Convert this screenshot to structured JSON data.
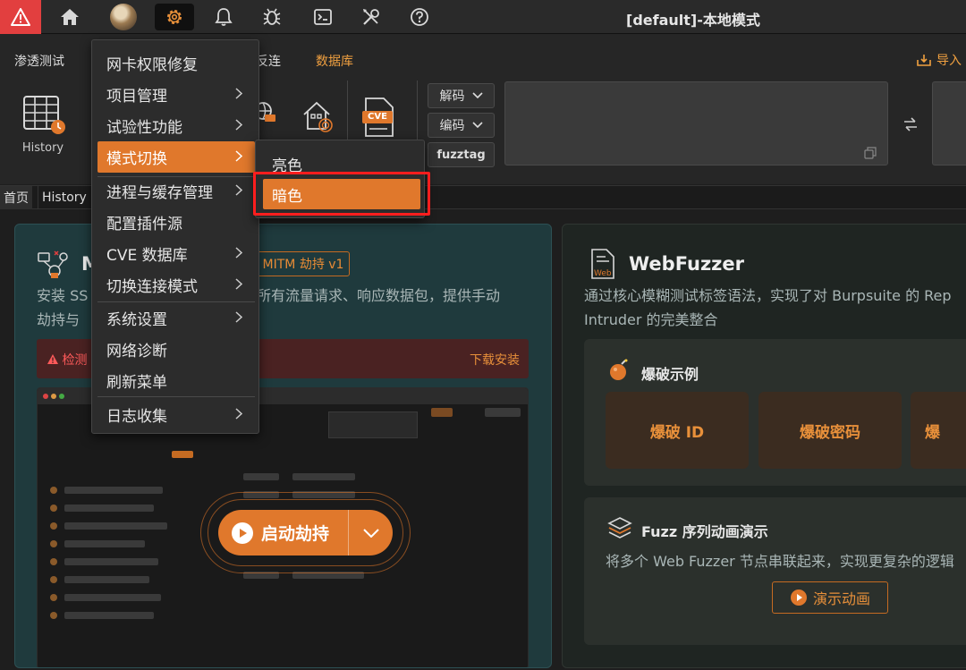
{
  "titlebar": {
    "title": "[default]-本地模式",
    "icons": [
      "warning-icon",
      "home-icon",
      "avatar",
      "gear-icon",
      "bell-icon",
      "bug-icon",
      "terminal-icon",
      "tools-icon",
      "help-icon"
    ]
  },
  "toolbar": {
    "tabs": [
      "渗透测试",
      "反连",
      "数据库"
    ],
    "import_label": "导入",
    "history_label": "History",
    "decode_label": "解码",
    "encode_label": "编码",
    "fuzztag_label": "fuzztag",
    "cve_label": "CVE"
  },
  "page_tabs": [
    "首页",
    "History"
  ],
  "menu": {
    "items": [
      {
        "label": "网卡权限修复",
        "has_sub": false
      },
      {
        "label": "项目管理",
        "has_sub": true
      },
      {
        "label": "试验性功能",
        "has_sub": true
      },
      {
        "label": "模式切换",
        "has_sub": true
      },
      {
        "label": "进程与缓存管理",
        "has_sub": true
      },
      {
        "label": "配置插件源",
        "has_sub": false
      },
      {
        "label": "CVE 数据库",
        "has_sub": true
      },
      {
        "label": "切换连接模式",
        "has_sub": true
      },
      {
        "label": "系统设置",
        "has_sub": true
      },
      {
        "label": "网络诊断",
        "has_sub": false
      },
      {
        "label": "刷新菜单",
        "has_sub": false
      },
      {
        "label": "日志收集",
        "has_sub": true
      }
    ],
    "highlighted": "模式切换"
  },
  "submenu": {
    "items": [
      "亮色",
      "暗色"
    ],
    "highlighted": "暗色"
  },
  "mitm_card": {
    "title_partial": "M",
    "badge": "MITM 劫持 v1",
    "desc_line1_left": "安装 SS",
    "desc_line1_right": "所有流量请求、响应数据包，提供手动",
    "desc_line2": "劫持与",
    "warn_text": "检测",
    "warn_link": "下载安装",
    "start_label": "启动劫持"
  },
  "webfuzzer_card": {
    "title": "WebFuzzer",
    "desc_line1": "通过核心模糊测试标签语法，实现了对 Burpsuite 的 Rep",
    "desc_line2": "Intruder 的完美整合",
    "brute_title": "爆破示例",
    "tiles": [
      "爆破 ID",
      "爆破密码",
      "爆"
    ],
    "fuzz_title": "Fuzz 序列动画演示",
    "fuzz_desc": "将多个 Web Fuzzer 节点串联起来，实现更复杂的逻辑",
    "demo_label": "演示动画"
  },
  "colors": {
    "accent": "#e0782c",
    "alert": "#e23f3f",
    "highlight_box": "#ff1e1e"
  }
}
